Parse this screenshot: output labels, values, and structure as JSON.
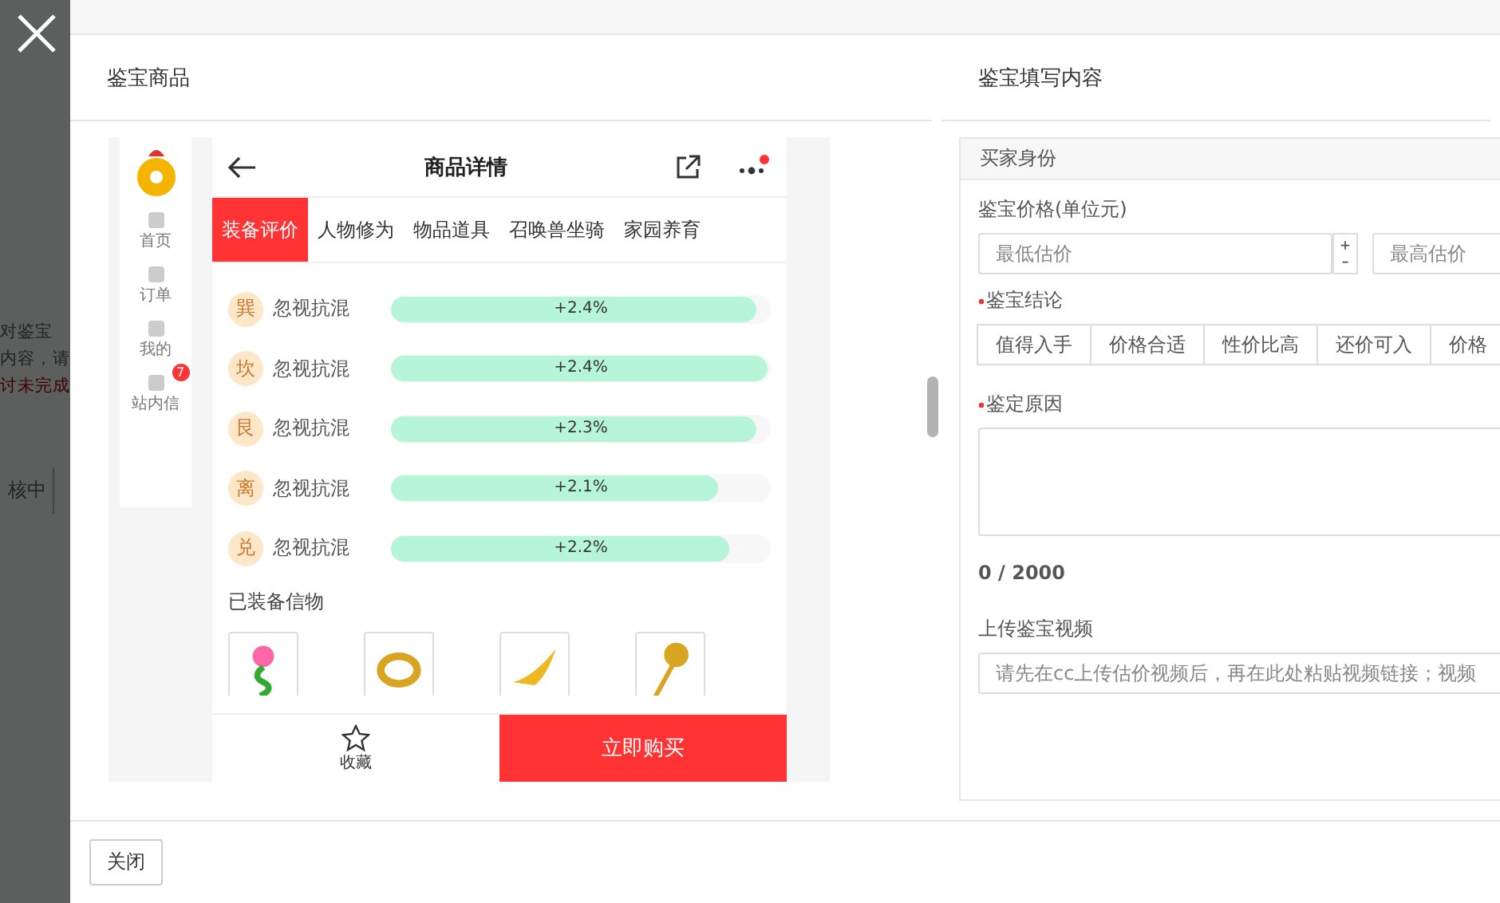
{
  "background": {
    "lines": [
      {
        "text": "对鉴宝",
        "kind": "normal"
      },
      {
        "text": "内容，请",
        "kind": "normal"
      },
      {
        "text": "讨未完成",
        "kind": "alert"
      }
    ],
    "status_cell": "核中"
  },
  "modal": {
    "left_title": "鉴宝商品",
    "right_title": "鉴宝填写内容",
    "close_button": "关闭"
  },
  "phone": {
    "sidebar": [
      {
        "label": "首页"
      },
      {
        "label": "订单"
      },
      {
        "label": "我的"
      },
      {
        "label": "站内信",
        "badge": "7"
      }
    ],
    "title": "商品详情",
    "tabs": [
      {
        "label": "装备评价",
        "selected": true
      },
      {
        "label": "人物修为",
        "selected": false
      },
      {
        "label": "物品道具",
        "selected": false
      },
      {
        "label": "召唤兽坐骑",
        "selected": false
      },
      {
        "label": "家园养育",
        "selected": false
      }
    ],
    "stats": [
      {
        "symbol": "巽",
        "name": "忽视抗混",
        "level": 0.97,
        "reading": "+2.4%"
      },
      {
        "symbol": "坎",
        "name": "忽视抗混",
        "level": 1.0,
        "reading": "+2.4%"
      },
      {
        "symbol": "艮",
        "name": "忽视抗混",
        "level": 0.97,
        "reading": "+2.3%"
      },
      {
        "symbol": "离",
        "name": "忽视抗混",
        "level": 0.87,
        "reading": "+2.1%"
      },
      {
        "symbol": "兑",
        "name": "忽视抗混",
        "level": 0.9,
        "reading": "+2.2%"
      }
    ],
    "equipped_title": "已装备信物",
    "items": [
      {
        "kind": "flower"
      },
      {
        "kind": "ring"
      },
      {
        "kind": "wing"
      },
      {
        "kind": "staff"
      }
    ],
    "favorite": "收藏",
    "buy": "立即购买"
  },
  "form": {
    "section": "买家身份",
    "price_label": "鉴宝价格(单位元)",
    "min": {
      "placeholder": "最低估价"
    },
    "max": {
      "placeholder": "最高估价"
    },
    "conclusion_label": "鉴宝结论",
    "conclusions": [
      {
        "label": "值得入手",
        "selected": false
      },
      {
        "label": "价格合适",
        "selected": false
      },
      {
        "label": "性价比高",
        "selected": false
      },
      {
        "label": "还价可入",
        "selected": false
      },
      {
        "label": "价格",
        "selected": false
      }
    ],
    "reason_label": "鉴定原因",
    "counter": "0 / 2000",
    "video_label": "上传鉴宝视频",
    "video": {
      "placeholder": "请先在cc上传估价视频后，再在此处粘贴视频链接；视频"
    }
  }
}
